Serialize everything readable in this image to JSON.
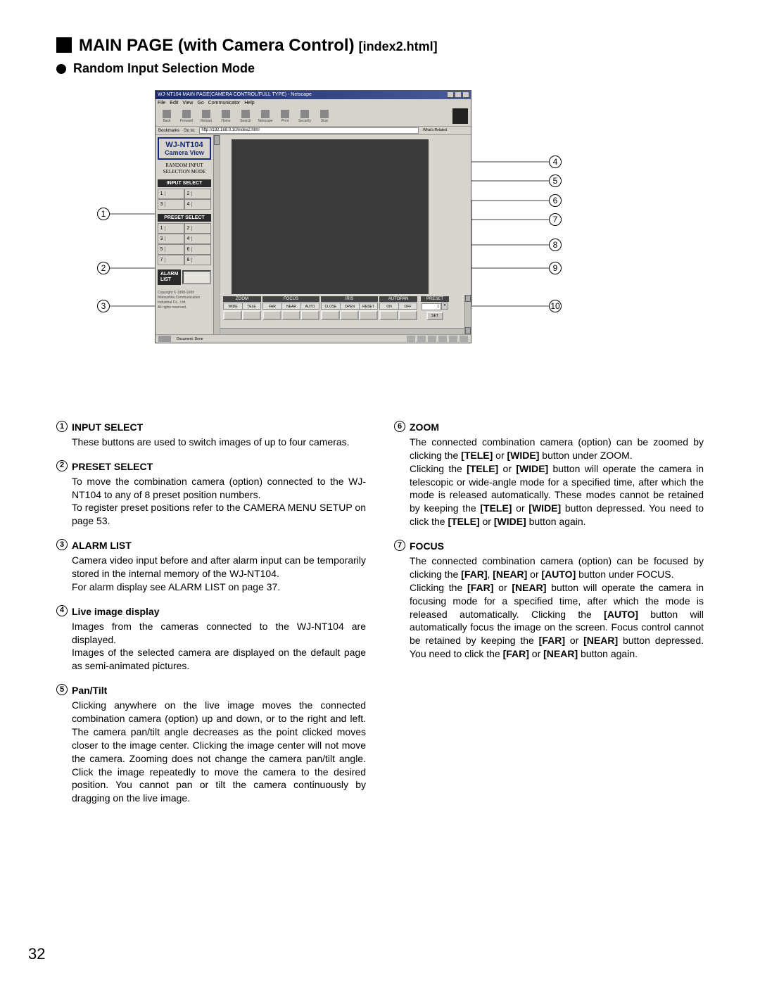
{
  "title": {
    "main": "MAIN PAGE (with Camera Control)",
    "file": "[index2.html]",
    "sub": "Random Input Selection Mode"
  },
  "page_number": "32",
  "screenshot": {
    "window_title": "WJ-NT104 MAIN PAGE(CAMERA CONTROL/FULL TYPE) - Netscape",
    "menus": [
      "File",
      "Edit",
      "View",
      "Go",
      "Communicator",
      "Help"
    ],
    "toolbar": [
      "Back",
      "Forward",
      "Reload",
      "Home",
      "Search",
      "Netscape",
      "Print",
      "Security",
      "Stop"
    ],
    "addr_bm": "Bookmarks",
    "addr_go": "Go to:",
    "url": "http://192.168.0.10/index2.html",
    "related": "What's Related",
    "status": "Document: Done",
    "sidebar": {
      "title1": "WJ-NT104",
      "title2": "Camera View",
      "mode1": "RANDOM INPUT",
      "mode2": "SELECTION MODE",
      "input_select": "INPUT SELECT",
      "input_nums": [
        "1",
        "2",
        "3",
        "4"
      ],
      "preset_select": "PRESET SELECT",
      "preset_nums": [
        "1",
        "2",
        "3",
        "4",
        "5",
        "6",
        "7",
        "8"
      ],
      "alarm": "ALARM\nLIST",
      "copyright": "Copyright © 1998-1999\nMatsushita Communication\nIndustrial Co., Ltd.\nAll rights reserved."
    },
    "controls": {
      "zoom": {
        "label": "ZOOM",
        "btns": [
          "WIDE",
          "TELE"
        ]
      },
      "focus": {
        "label": "FOCUS",
        "btns": [
          "FAR",
          "NEAR",
          "AUTO"
        ]
      },
      "iris": {
        "label": "IRIS",
        "btns": [
          "CLOSE",
          "OPEN",
          "RESET"
        ]
      },
      "autopan": {
        "label": "AUTOPAN",
        "btns": [
          "ON",
          "OFF"
        ]
      },
      "preset": {
        "label": "PRESET",
        "sel": "1",
        "set": "SET"
      }
    }
  },
  "callouts_left": {
    "1": "1",
    "2": "2",
    "3": "3"
  },
  "callouts_right": {
    "4": "4",
    "5": "5",
    "6": "6",
    "7": "7",
    "8": "8",
    "9": "9",
    "10": "10"
  },
  "descriptions": {
    "left": [
      {
        "num": "1",
        "title": "INPUT SELECT",
        "body": "These buttons are used to switch images of up to four cameras."
      },
      {
        "num": "2",
        "title": "PRESET SELECT",
        "body": "To move the combination camera (option) connected to the WJ-NT104 to any of 8 preset position numbers.\nTo register preset positions refer to the CAMERA MENU SETUP on page 53."
      },
      {
        "num": "3",
        "title": "ALARM LIST",
        "body": "Camera video input before and after alarm input can be temporarily stored in the internal memory of the WJ-NT104.\nFor alarm display see ALARM LIST on page 37."
      },
      {
        "num": "4",
        "title": "Live image display",
        "body": "Images from the cameras connected to the WJ-NT104 are displayed.\nImages of the selected camera are displayed on the default page as semi-animated pictures."
      },
      {
        "num": "5",
        "title": "Pan/Tilt",
        "body": "Clicking anywhere on the live image moves the connected combination camera (option) up and down, or to the right and left.  The camera pan/tilt angle decreases as the point clicked moves closer to the image center.  Clicking the image center will not move the camera.  Zooming does not change the camera pan/tilt angle.  Click the image repeatedly to move the camera to the desired position. You cannot pan or tilt the camera continuously by dragging on the live image."
      }
    ],
    "right": [
      {
        "num": "6",
        "title": "ZOOM",
        "body": "The connected combination camera (option) can be zoomed by clicking the <b>[TELE]</b> or <b>[WIDE]</b> button under ZOOM.\nClicking the <b>[TELE]</b> or <b>[WIDE]</b> button will operate the camera in telescopic or wide-angle mode for a specified time, after which the mode is released automatically.  These modes cannot be retained by keeping the <b>[TELE]</b> or <b>[WIDE]</b> button depressed.  You need to click the <b>[TELE]</b> or <b>[WIDE]</b> button again."
      },
      {
        "num": "7",
        "title": "FOCUS",
        "body": "The connected combination camera (option) can be focused by clicking the <b>[FAR]</b>, <b>[NEAR]</b> or <b>[AUTO]</b> button under FOCUS.\nClicking the <b>[FAR]</b> or <b>[NEAR]</b> button will operate the camera in focusing mode for a specified time, after which the mode is released automatically.  Clicking the <b>[AUTO]</b> button will automatically focus the image on the screen.  Focus control cannot be retained by keeping the <b>[FAR]</b> or <b>[NEAR]</b> button depressed.  You need to click the <b>[FAR]</b> or <b>[NEAR]</b> button again."
      }
    ]
  }
}
